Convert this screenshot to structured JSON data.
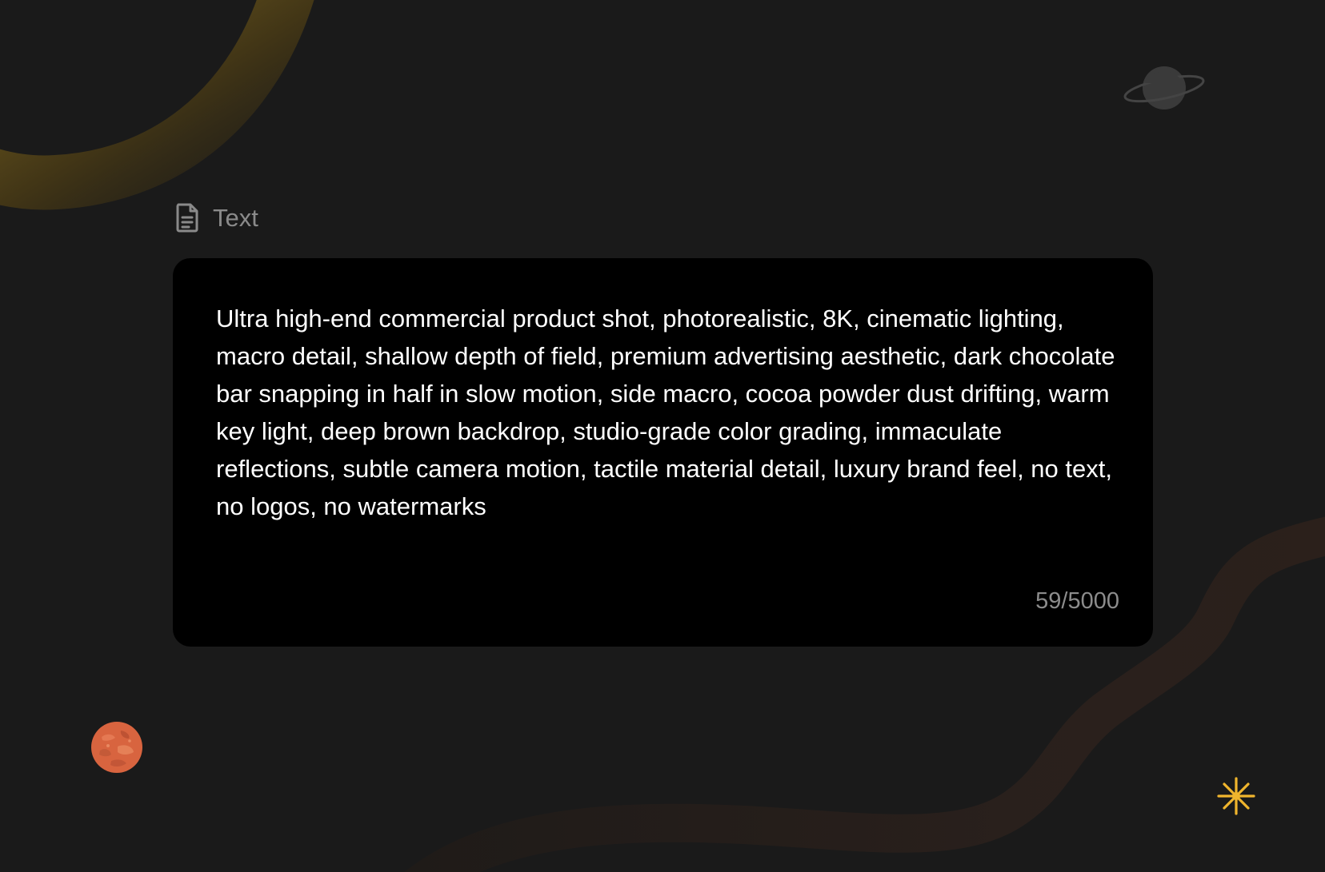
{
  "section": {
    "icon": "document-icon",
    "label": "Text"
  },
  "prompt": {
    "value": "Ultra high-end commercial product shot, photorealistic, 8K, cinematic lighting, macro detail, shallow depth of field, premium advertising aesthetic, dark chocolate bar snapping in half in slow motion, side macro, cocoa powder dust drifting, warm key light, deep brown backdrop, studio-grade color grading, immaculate reflections, subtle camera motion, tactile material detail, luxury brand feel, no text, no logos, no watermarks",
    "counter": "59/5000"
  },
  "decorations": {
    "ringed_planet_icon": "ringed-planet-icon",
    "mars_planet_icon": "mars-planet-icon",
    "sparkle_icon": "sparkle-icon"
  },
  "colors": {
    "background": "#1a1a1a",
    "card": "#000000",
    "text": "#ffffff",
    "muted": "#8a8a8a",
    "accent_gold": "#f0b52d",
    "swirl_gold": "#5a4a1a",
    "swirl_brown": "#2a211d",
    "mars": "#d8643f"
  }
}
